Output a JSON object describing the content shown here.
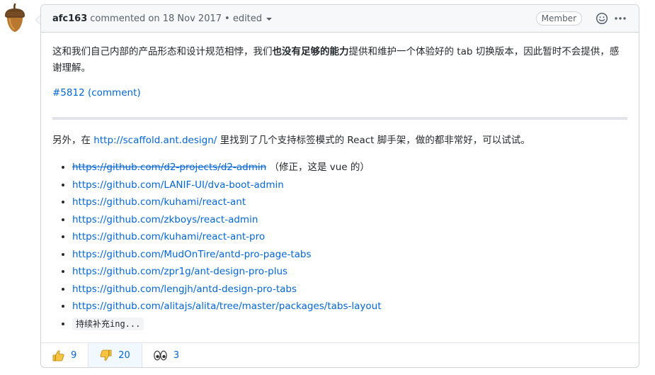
{
  "comment": {
    "author": "afc163",
    "meta": "commented on 18 Nov 2017",
    "edited": "• edited",
    "badge": "Member"
  },
  "body": {
    "p1_before": "这和我们自己内部的产品形态和设计规范相悖，我们",
    "p1_bold": "也没有足够的能力",
    "p1_after": "提供和维护一个体验好的 tab 切换版本，因此暂时不会提供，感谢理解。",
    "ref_link": "#5812 (comment)",
    "p2_before": "另外，在 ",
    "p2_link": "http://scaffold.ant.design/",
    "p2_after": " 里找到了几个支持标签模式的 React 脚手架，做的都非常好，可以试试。"
  },
  "links": [
    "https://github.com/d2-projects/d2-admin",
    "https://github.com/LANIF-UI/dva-boot-admin",
    "https://github.com/kuhami/react-ant",
    "https://github.com/zkboys/react-admin",
    "https://github.com/kuhami/react-ant-pro",
    "https://github.com/MudOnTire/antd-pro-page-tabs",
    "https://github.com/zpr1g/ant-design-pro-plus",
    "https://github.com/lengjh/antd-design-pro-tabs",
    "https://github.com/alitajs/alita/tree/master/packages/tabs-layout"
  ],
  "link0_note": " （修正，这是 vue 的）",
  "last_item": "持续补充ing...",
  "reactions": {
    "thumbs_up": "9",
    "thumbs_down": "20",
    "eyes": "3"
  },
  "icons": {
    "avatar": "acorn-icon",
    "smiley": "smiley-icon",
    "kebab": "kebab-icon",
    "thumbs_up": "thumbs-up-icon",
    "thumbs_down": "thumbs-down-icon",
    "eyes": "eyes-icon"
  },
  "colors": {
    "link": "#0366d6",
    "header_bg": "#f6f8fa",
    "border": "#d1d5da",
    "active_reaction_bg": "#f1f8ff"
  }
}
